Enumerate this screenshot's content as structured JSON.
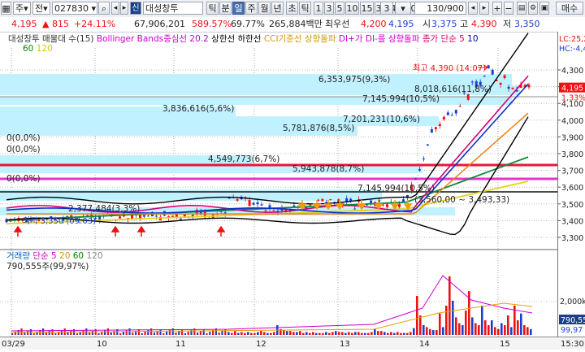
{
  "toolbar": {
    "market": "주",
    "mode": "전",
    "code": "027830",
    "badge": "신",
    "stock_name": "대성창투",
    "periods": [
      "틱",
      "분",
      "일",
      "주",
      "월",
      "년"
    ],
    "active_period": "일",
    "subperiods": [
      "초",
      "틱"
    ],
    "numbers": [
      "1",
      "3",
      "5",
      "10",
      "15",
      "30",
      "45",
      "60"
    ],
    "count_select": "3",
    "count_display": "130/900",
    "buy_button": "매수"
  },
  "infobar": {
    "price": "4,195",
    "change": "▲ 815",
    "change_pct": "+24.11%",
    "volume": "67,906,201",
    "volume_pct": "589.57%",
    "pct2": "69.77%",
    "amount": "265,884백만",
    "label_min": "최우선",
    "ask": "4,200",
    "bid": "4,195",
    "open_label": "시",
    "open": "3,375",
    "high_label": "고",
    "high": "4,390",
    "low_label": "저",
    "low": "3,350"
  },
  "legend": {
    "series1": "대성창투 매물대 수(15)",
    "series2": "Bollinger Bands중심선 20.2",
    "series3": "상한선",
    "series4": "하한선",
    "series5": "CCI기준선 상향돌파",
    "series6": "DI+가 DI-를 상향돌파",
    "series7": "종가 단순 5",
    "series8": "10",
    "series9": "60",
    "series10": "120",
    "right1": "LC:25,2",
    "right2": "HC:-4,4"
  },
  "volume_panel": {
    "title": "거래량",
    "ma_label": "단순",
    "ma1": "5",
    "ma2": "20",
    "ma3": "60",
    "ma4": "120",
    "max_label": "790,555주(99,97%)",
    "axis_label": "2,000k",
    "current": "790,55",
    "pct": "99,97"
  },
  "annotations": {
    "high": "최고 4,390 (14:07)",
    "low": "최저 3,350 (09:03)",
    "range": "(3,560,00 ~ 3,493,33)",
    "vp": [
      "6,353,975(9,3%)",
      "8,018,616(11,8%)",
      "7,145,994(10,5%)",
      "3,836,616(5,6%)",
      "7,201,231(10,6%)",
      "5,781,876(8,5%)",
      "0(0,0%)",
      "0(0,0%)",
      "4,549,773(6,7%)",
      "5,943,878(8,7%)",
      "0(0,0%)",
      "7,145,994(10,5%)",
      "2,377,484(3,3%)"
    ]
  },
  "price_axis": {
    "ticks": [
      "4,300",
      "4,200",
      "4,100",
      "4,000",
      "3,900",
      "3,800",
      "3,700",
      "3,600",
      "3,500",
      "3,400",
      "3,300"
    ],
    "current_price": "4,195",
    "current_pct": "1,33%"
  },
  "x_axis": {
    "labels": [
      "03/29",
      "10",
      "11",
      "12",
      "13",
      "14",
      "15"
    ],
    "right_label": "15:30"
  },
  "colors": {
    "up": "#e11",
    "down": "#1a3fd0",
    "vp_band": "#bff1ff",
    "red_line": "#e8173a",
    "magenta_line": "#e633cc"
  }
}
